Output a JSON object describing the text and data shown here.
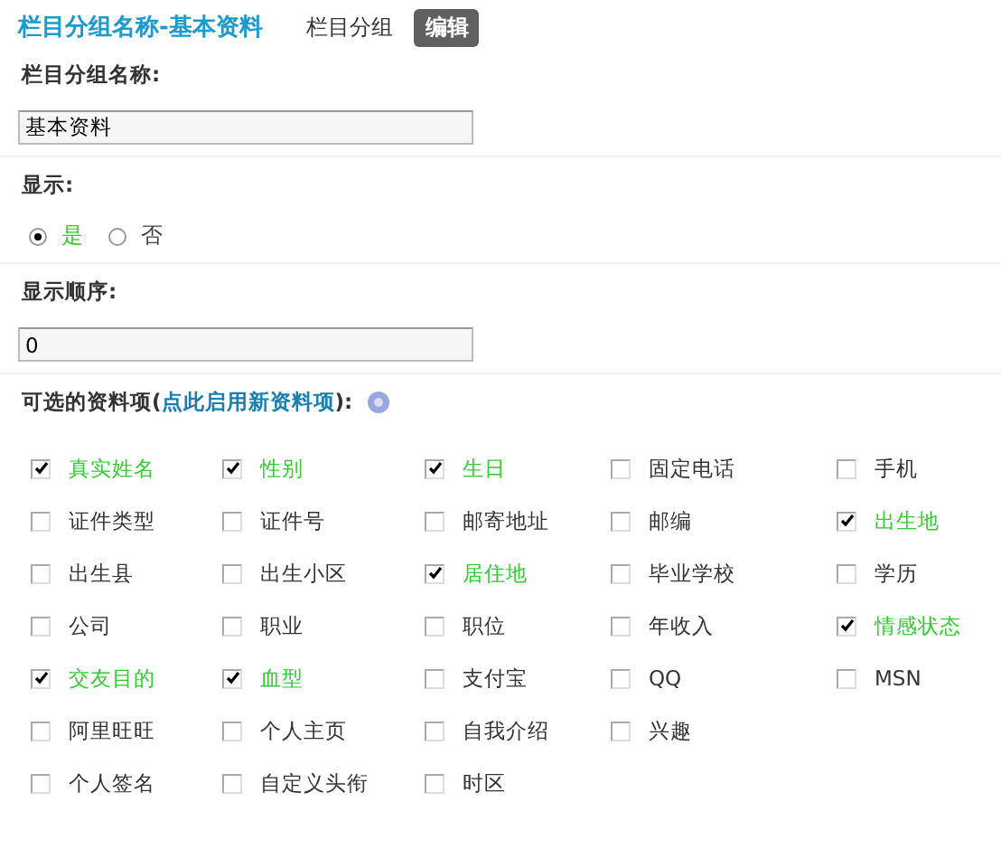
{
  "title": "栏目分组名称-基本资料",
  "tabs": [
    {
      "label": "栏目分组",
      "selected": false
    },
    {
      "label": "编辑",
      "selected": true
    }
  ],
  "name_field": {
    "label": "栏目分组名称:",
    "value": "基本资料"
  },
  "display": {
    "label": "显示:",
    "options": [
      {
        "label": "是",
        "selected": true
      },
      {
        "label": "否",
        "selected": false
      }
    ]
  },
  "order_field": {
    "label": "显示顺序:",
    "value": "0"
  },
  "fields_heading": {
    "label": "可选的资料项(",
    "link": "点此启用新资料项",
    "suffix": "):"
  },
  "field_rows": [
    [
      {
        "label": "真实姓名",
        "checked": true
      },
      {
        "label": "性别",
        "checked": true
      },
      {
        "label": "生日",
        "checked": true
      },
      {
        "label": "固定电话",
        "checked": false
      },
      {
        "label": "手机",
        "checked": false
      }
    ],
    [
      {
        "label": "证件类型",
        "checked": false
      },
      {
        "label": "证件号",
        "checked": false
      },
      {
        "label": "邮寄地址",
        "checked": false
      },
      {
        "label": "邮编",
        "checked": false
      },
      {
        "label": "出生地",
        "checked": true
      }
    ],
    [
      {
        "label": "出生县",
        "checked": false
      },
      {
        "label": "出生小区",
        "checked": false
      },
      {
        "label": "居住地",
        "checked": true
      },
      {
        "label": "毕业学校",
        "checked": false
      },
      {
        "label": "学历",
        "checked": false
      }
    ],
    [
      {
        "label": "公司",
        "checked": false
      },
      {
        "label": "职业",
        "checked": false
      },
      {
        "label": "职位",
        "checked": false
      },
      {
        "label": "年收入",
        "checked": false
      },
      {
        "label": "情感状态",
        "checked": true
      }
    ],
    [
      {
        "label": "交友目的",
        "checked": true
      },
      {
        "label": "血型",
        "checked": true
      },
      {
        "label": "支付宝",
        "checked": false
      },
      {
        "label": "QQ",
        "checked": false
      },
      {
        "label": "MSN",
        "checked": false
      }
    ],
    [
      {
        "label": "阿里旺旺",
        "checked": false
      },
      {
        "label": "个人主页",
        "checked": false
      },
      {
        "label": "自我介绍",
        "checked": false
      },
      {
        "label": "兴趣",
        "checked": false
      }
    ],
    [
      {
        "label": "个人签名",
        "checked": false
      },
      {
        "label": "自定义头衔",
        "checked": false
      },
      {
        "label": "时区",
        "checked": false
      }
    ]
  ]
}
